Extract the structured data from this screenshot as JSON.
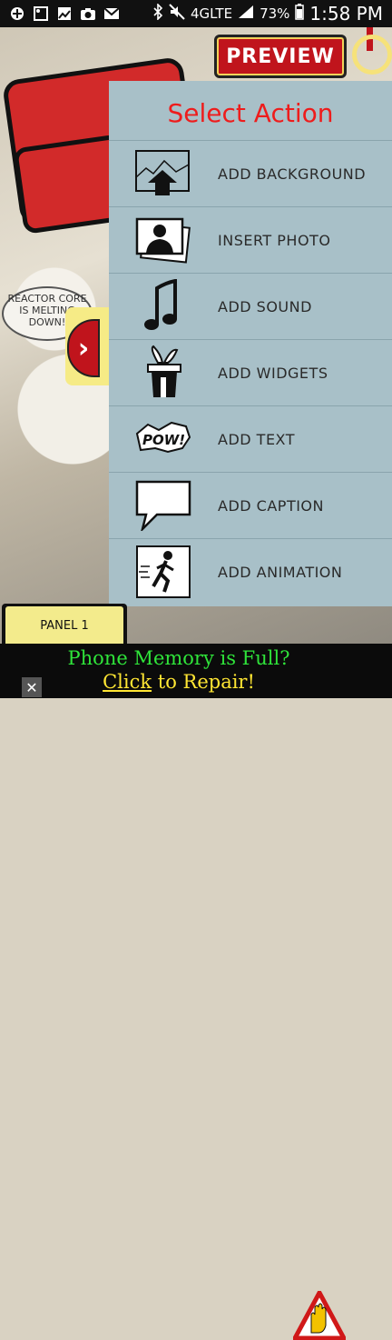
{
  "status_bar": {
    "left_icons": [
      "add-icon",
      "image-icon",
      "gallery-icon",
      "camera-icon",
      "mail-icon"
    ],
    "network": "4GLTE",
    "battery": "73%",
    "time": "1:58 PM"
  },
  "toolbar": {
    "preview_label": "PREVIEW"
  },
  "background": {
    "bubble_text": "REACTOR CORE IS MELTING DOWN!"
  },
  "menu": {
    "title": "Select Action",
    "items": [
      {
        "label": "ADD BACKGROUND",
        "icon": "background-upload-icon"
      },
      {
        "label": "INSERT PHOTO",
        "icon": "photo-icon"
      },
      {
        "label": "ADD SOUND",
        "icon": "music-note-icon"
      },
      {
        "label": "ADD WIDGETS",
        "icon": "magic-hat-icon"
      },
      {
        "label": "ADD TEXT",
        "icon": "pow-text-icon"
      },
      {
        "label": "ADD CAPTION",
        "icon": "speech-bubble-icon"
      },
      {
        "label": "ADD ANIMATION",
        "icon": "running-man-icon"
      }
    ]
  },
  "panel_tab": {
    "label": "PANEL 1"
  },
  "ad": {
    "line1": "Phone Memory is Full?",
    "line2_link": "Click",
    "line2_rest": " to Repair!",
    "close": "✕"
  },
  "colors": {
    "panel_bg": "#a8c0c8",
    "title_red": "#ee1c1c",
    "accent_red": "#c0141c"
  }
}
